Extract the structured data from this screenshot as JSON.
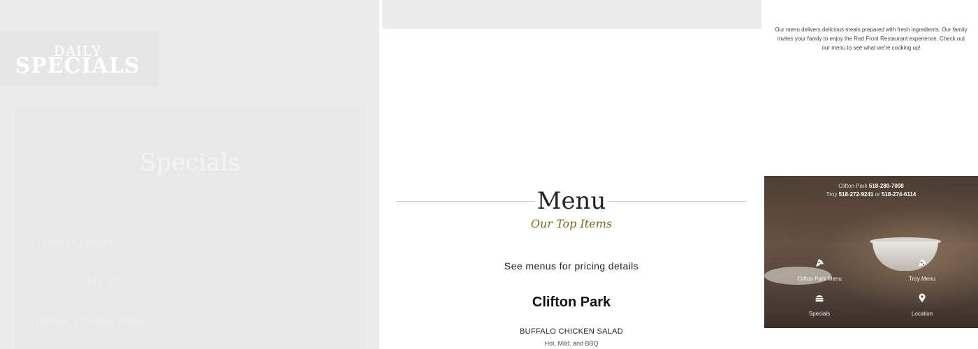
{
  "left_panel": {
    "logo_daily": "DAILY",
    "logo_specials": "SPECIALS",
    "panel_title": "Specials",
    "panel_subtitle": "",
    "item_1": "Tuesday Special",
    "item_1_price": "$11.95",
    "item_2": "Buffalo Chicken Salad"
  },
  "menu_section": {
    "heading": "Menu",
    "subheading": "Our Top Items",
    "pricing_note": "See menus for pricing details",
    "location_title": "Clifton Park",
    "first_item_name": "BUFFALO CHICKEN SALAD",
    "first_item_desc": "Hot, Mild, and BBQ"
  },
  "intro": {
    "text": "Our menu delivers delicious meals prepared with fresh ingredients. Our family invites your family to enjoy the Red Front Restaurant experience. Check out our menu to see what we're cooking up!"
  },
  "contact": {
    "clifton_label": "Clifton Park",
    "clifton_phone": "518-280-7008",
    "troy_label": "Troy",
    "troy_phone_1": "518-272-9241",
    "or_word": "or",
    "troy_phone_2": "518-274-6114"
  },
  "nav_tiles": [
    {
      "label": "Clifton Park Menu",
      "icon": "pizza-slice-icon"
    },
    {
      "label": "Troy Menu",
      "icon": "pizza-slice-icon"
    },
    {
      "label": "Specials",
      "icon": "burger-icon"
    },
    {
      "label": "Location",
      "icon": "map-pin-icon"
    }
  ],
  "colors": {
    "accent_olive": "#7a6a1e",
    "panel_bg": "#ebebeb"
  }
}
